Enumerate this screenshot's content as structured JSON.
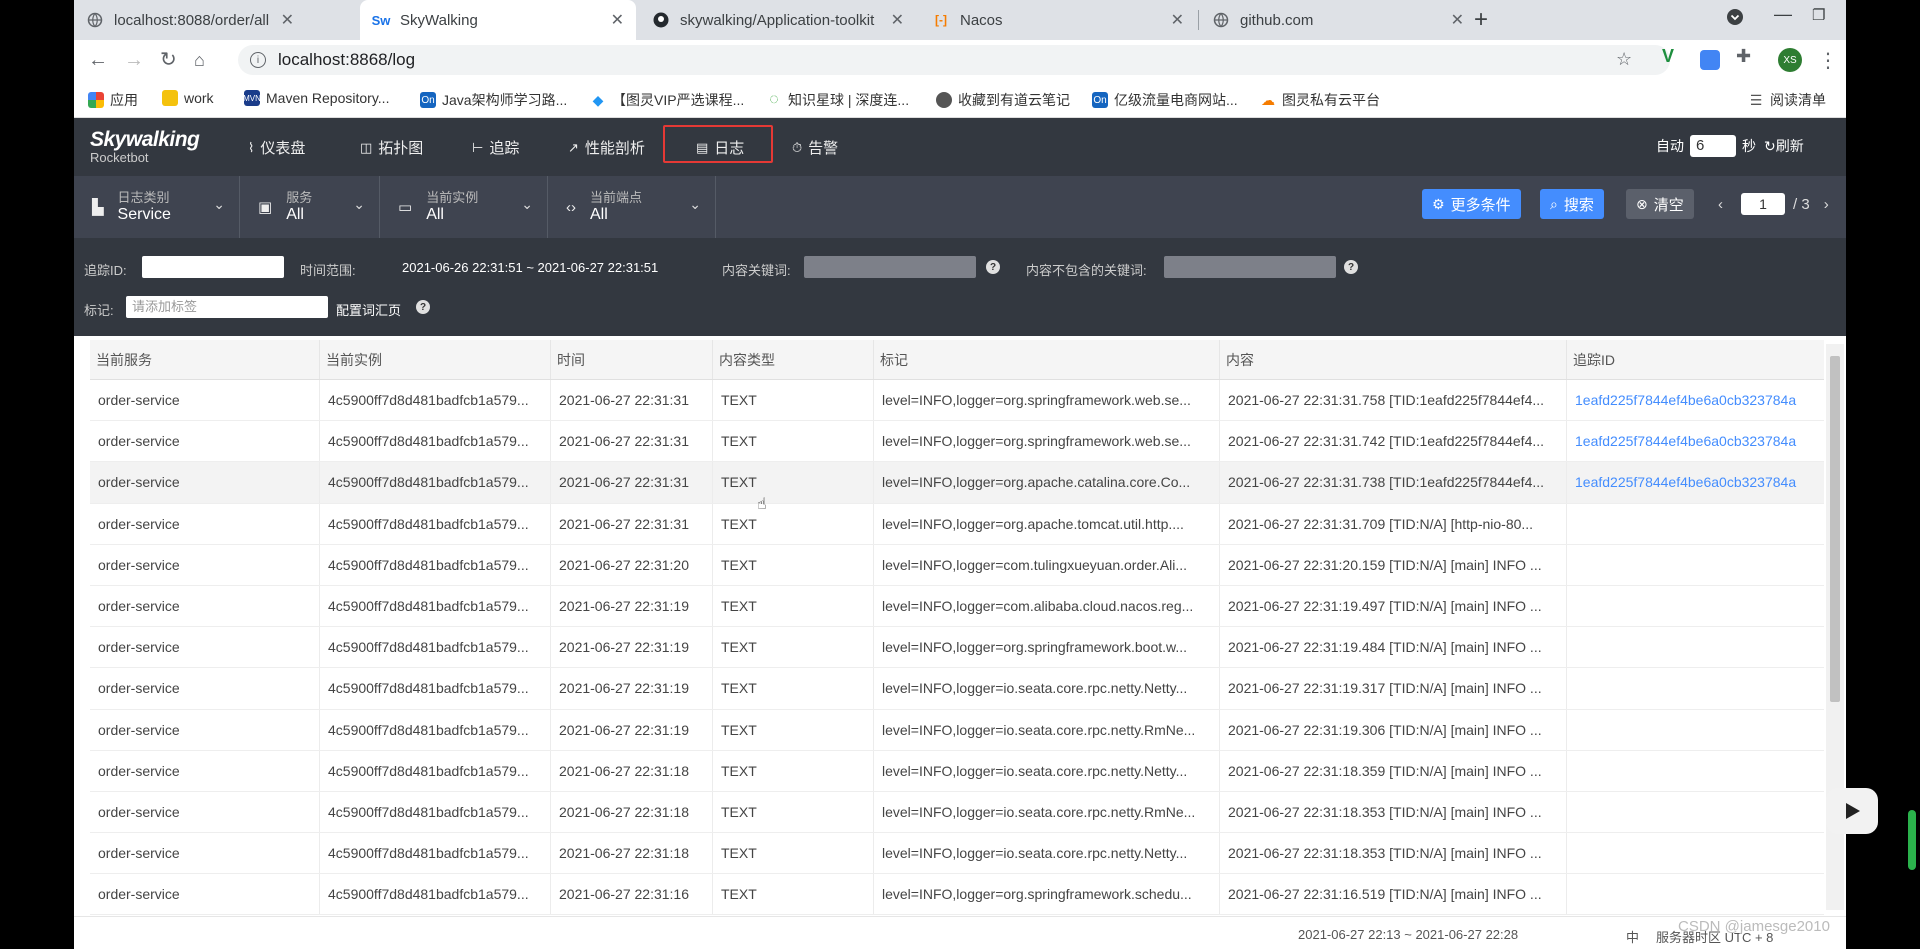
{
  "browser": {
    "tabs": [
      {
        "title": "localhost:8088/order/all",
        "icon": "globe-icon",
        "active": false
      },
      {
        "title": "SkyWalking",
        "icon": "skywalking-icon",
        "active": true
      },
      {
        "title": "skywalking/Application-toolkit",
        "icon": "github-icon",
        "active": false
      },
      {
        "title": "Nacos",
        "icon": "nacos-icon",
        "active": false
      },
      {
        "title": "github.com",
        "icon": "globe-icon",
        "active": false
      }
    ],
    "url": "localhost:8868/log",
    "profile_initials": "XS",
    "bookmarks": [
      {
        "label": "应用",
        "icon": "apps-grid-icon",
        "color": "#ea4335"
      },
      {
        "label": "work",
        "icon": "folder-icon",
        "color": "#f4c20d"
      },
      {
        "label": "Maven Repository...",
        "icon": "maven-icon",
        "color": "#1a3c8a"
      },
      {
        "label": "Java架构师学习路...",
        "icon": "on-icon",
        "color": "#1565c0"
      },
      {
        "label": "【图灵VIP严选课程...",
        "icon": "diamond-icon",
        "color": "#2196f3"
      },
      {
        "label": "知识星球 | 深度连...",
        "icon": "star-circle-icon",
        "color": "#4caf50"
      },
      {
        "label": "收藏到有道云笔记",
        "icon": "globe-icon",
        "color": "#555555"
      },
      {
        "label": "亿级流量电商网站...",
        "icon": "on-icon",
        "color": "#1565c0"
      },
      {
        "label": "图灵私有云平台",
        "icon": "cloud-icon",
        "color": "#f57c00"
      }
    ],
    "reading_list": "阅读清单"
  },
  "app": {
    "logo_main": "Skywalking",
    "logo_sub": "Rocketbot",
    "nav": [
      {
        "label": "仪表盘",
        "icon": "dashboard-icon"
      },
      {
        "label": "拓扑图",
        "icon": "topology-icon"
      },
      {
        "label": "追踪",
        "icon": "trace-icon"
      },
      {
        "label": "性能剖析",
        "icon": "profile-icon"
      },
      {
        "label": "日志",
        "icon": "log-icon"
      },
      {
        "label": "告警",
        "icon": "alarm-icon"
      }
    ],
    "auto_label": "自动",
    "auto_value": "6",
    "seconds_label": "秒",
    "refresh_label": "刷新"
  },
  "toolbar": {
    "selectors": [
      {
        "title": "日志类别",
        "value": "Service",
        "icon": "chart-icon"
      },
      {
        "title": "服务",
        "value": "All",
        "icon": "box-icon"
      },
      {
        "title": "当前实例",
        "value": "All",
        "icon": "instance-icon"
      },
      {
        "title": "当前端点",
        "value": "All",
        "icon": "code-icon"
      }
    ],
    "more_conditions": "更多条件",
    "search": "搜索",
    "clear": "清空",
    "page_current": "1",
    "page_total": "/ 3"
  },
  "filters": {
    "trace_id_label": "追踪ID:",
    "time_range_label": "时间范围:",
    "time_range_value": "2021-06-26 22:31:51 ~ 2021-06-27 22:31:51",
    "keywords_label": "内容关键词:",
    "exclude_keywords_label": "内容不包含的关键词:",
    "tags_label": "标记:",
    "tags_placeholder": "请添加标签",
    "config_page": "配置词汇页"
  },
  "table": {
    "columns": [
      "当前服务",
      "当前实例",
      "时间",
      "内容类型",
      "标记",
      "内容",
      "追踪ID"
    ],
    "rows": [
      [
        "order-service",
        "4c5900ff7d8d481badfcb1a579...",
        "2021-06-27 22:31:31",
        "TEXT",
        "level=INFO,logger=org.springframework.web.se...",
        "2021-06-27 22:31:31.758 [TID:1eafd225f7844ef4...",
        "1eafd225f7844ef4be6a0cb323784a"
      ],
      [
        "order-service",
        "4c5900ff7d8d481badfcb1a579...",
        "2021-06-27 22:31:31",
        "TEXT",
        "level=INFO,logger=org.springframework.web.se...",
        "2021-06-27 22:31:31.742 [TID:1eafd225f7844ef4...",
        "1eafd225f7844ef4be6a0cb323784a"
      ],
      [
        "order-service",
        "4c5900ff7d8d481badfcb1a579...",
        "2021-06-27 22:31:31",
        "TEXT",
        "level=INFO,logger=org.apache.catalina.core.Co...",
        "2021-06-27 22:31:31.738 [TID:1eafd225f7844ef4...",
        "1eafd225f7844ef4be6a0cb323784a"
      ],
      [
        "order-service",
        "4c5900ff7d8d481badfcb1a579...",
        "2021-06-27 22:31:31",
        "TEXT",
        "level=INFO,logger=org.apache.tomcat.util.http....",
        "2021-06-27 22:31:31.709 [TID:N/A] [http-nio-80...",
        ""
      ],
      [
        "order-service",
        "4c5900ff7d8d481badfcb1a579...",
        "2021-06-27 22:31:20",
        "TEXT",
        "level=INFO,logger=com.tulingxueyuan.order.Ali...",
        "2021-06-27 22:31:20.159 [TID:N/A] [main] INFO ...",
        ""
      ],
      [
        "order-service",
        "4c5900ff7d8d481badfcb1a579...",
        "2021-06-27 22:31:19",
        "TEXT",
        "level=INFO,logger=com.alibaba.cloud.nacos.reg...",
        "2021-06-27 22:31:19.497 [TID:N/A] [main] INFO ...",
        ""
      ],
      [
        "order-service",
        "4c5900ff7d8d481badfcb1a579...",
        "2021-06-27 22:31:19",
        "TEXT",
        "level=INFO,logger=org.springframework.boot.w...",
        "2021-06-27 22:31:19.484 [TID:N/A] [main] INFO ...",
        ""
      ],
      [
        "order-service",
        "4c5900ff7d8d481badfcb1a579...",
        "2021-06-27 22:31:19",
        "TEXT",
        "level=INFO,logger=io.seata.core.rpc.netty.Netty...",
        "2021-06-27 22:31:19.317 [TID:N/A] [main] INFO ...",
        ""
      ],
      [
        "order-service",
        "4c5900ff7d8d481badfcb1a579...",
        "2021-06-27 22:31:19",
        "TEXT",
        "level=INFO,logger=io.seata.core.rpc.netty.RmNe...",
        "2021-06-27 22:31:19.306 [TID:N/A] [main] INFO ...",
        ""
      ],
      [
        "order-service",
        "4c5900ff7d8d481badfcb1a579...",
        "2021-06-27 22:31:18",
        "TEXT",
        "level=INFO,logger=io.seata.core.rpc.netty.Netty...",
        "2021-06-27 22:31:18.359 [TID:N/A] [main] INFO ...",
        ""
      ],
      [
        "order-service",
        "4c5900ff7d8d481badfcb1a579...",
        "2021-06-27 22:31:18",
        "TEXT",
        "level=INFO,logger=io.seata.core.rpc.netty.RmNe...",
        "2021-06-27 22:31:18.353 [TID:N/A] [main] INFO ...",
        ""
      ],
      [
        "order-service",
        "4c5900ff7d8d481badfcb1a579...",
        "2021-06-27 22:31:18",
        "TEXT",
        "level=INFO,logger=io.seata.core.rpc.netty.Netty...",
        "2021-06-27 22:31:18.353 [TID:N/A] [main] INFO ...",
        ""
      ],
      [
        "order-service",
        "4c5900ff7d8d481badfcb1a579...",
        "2021-06-27 22:31:16",
        "TEXT",
        "level=INFO,logger=org.springframework.schedu...",
        "2021-06-27 22:31:16.519 [TID:N/A] [main] INFO ...",
        ""
      ]
    ]
  },
  "footer": {
    "time_range": "2021-06-27 22:13 ~ 2021-06-27 22:28",
    "lang": "中",
    "timezone": "服务器时区 UTC + 8"
  },
  "watermark": "CSDN @jamesge2010",
  "colors": {
    "nav_bg": "#333840",
    "toolbar_bg": "#3f4450",
    "accent_blue": "#448dfe",
    "highlight_red": "#e53935"
  }
}
